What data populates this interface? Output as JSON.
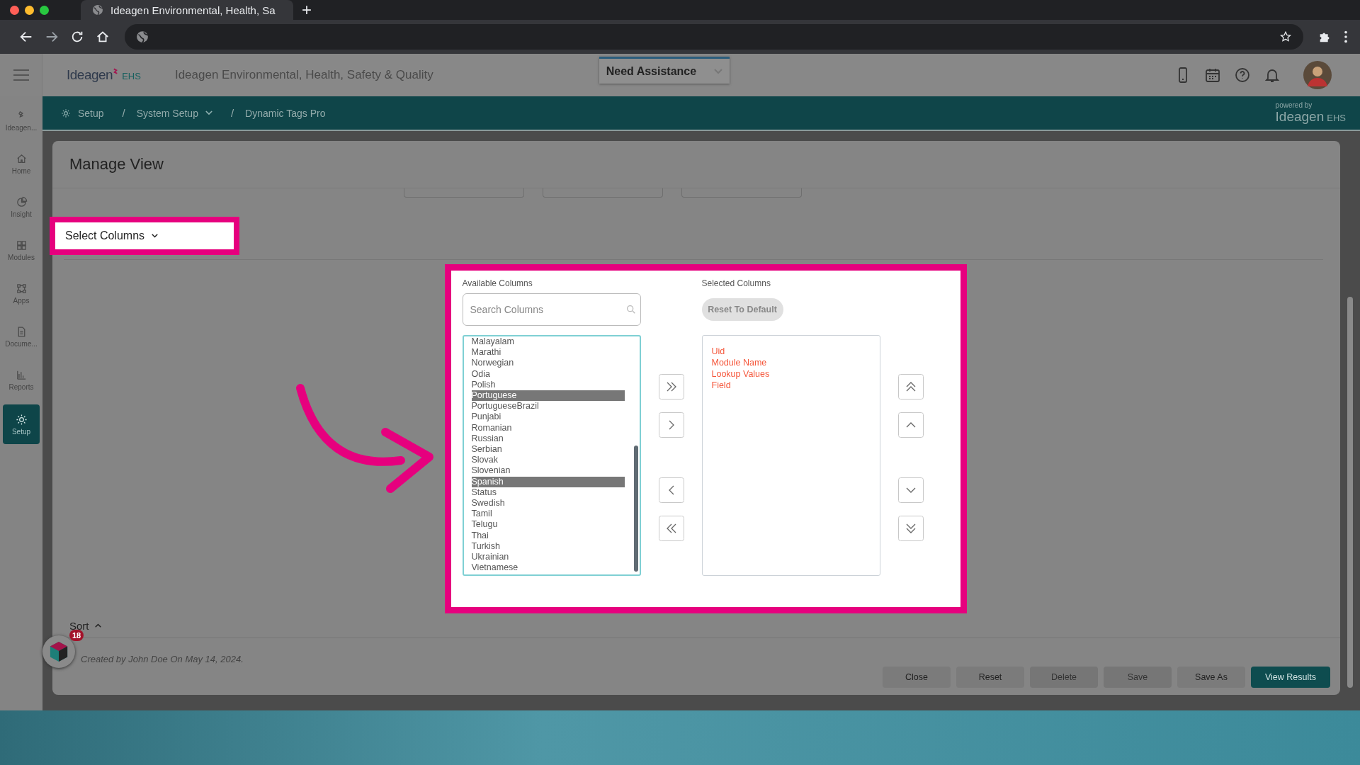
{
  "browser": {
    "tab_title": "Ideagen Environmental, Health, Sa",
    "new_tab": "+"
  },
  "header": {
    "logo": "Ideagen",
    "logo_suffix": "EHS",
    "title": "Ideagen Environmental, Health, Safety & Quality",
    "assistance": "Need Assistance"
  },
  "breadcrumb": {
    "separator": "/",
    "items": [
      {
        "label": "Setup",
        "dropdown": false
      },
      {
        "label": "System Setup",
        "dropdown": true
      },
      {
        "label": "Dynamic Tags Pro",
        "dropdown": false
      }
    ],
    "powered_by": "powered by",
    "brand": "Ideagen",
    "brand_suffix": "EHS"
  },
  "sidebar": {
    "items": [
      {
        "label": "Ideagen...",
        "selected": false
      },
      {
        "label": "Home",
        "selected": false
      },
      {
        "label": "Insight",
        "selected": false
      },
      {
        "label": "Modules",
        "selected": false
      },
      {
        "label": "Apps",
        "selected": false
      },
      {
        "label": "Docume...",
        "selected": false
      },
      {
        "label": "Reports",
        "selected": false
      },
      {
        "label": "Setup",
        "selected": true
      }
    ]
  },
  "page": {
    "title": "Manage View",
    "select_columns": "Select Columns"
  },
  "dialog": {
    "available_label": "Available Columns",
    "search": {
      "placeholder": "Search Columns"
    },
    "available": [
      {
        "label": "Malayalam",
        "selected": false
      },
      {
        "label": "Marathi",
        "selected": false
      },
      {
        "label": "Norwegian",
        "selected": false
      },
      {
        "label": "Odia",
        "selected": false
      },
      {
        "label": "Polish",
        "selected": false
      },
      {
        "label": "Portuguese",
        "selected": true
      },
      {
        "label": "PortugueseBrazil",
        "selected": false
      },
      {
        "label": "Punjabi",
        "selected": false
      },
      {
        "label": "Romanian",
        "selected": false
      },
      {
        "label": "Russian",
        "selected": false
      },
      {
        "label": "Serbian",
        "selected": false
      },
      {
        "label": "Slovak",
        "selected": false
      },
      {
        "label": "Slovenian",
        "selected": false
      },
      {
        "label": "Spanish",
        "selected": true
      },
      {
        "label": "Status",
        "selected": false
      },
      {
        "label": "Swedish",
        "selected": false
      },
      {
        "label": "Tamil",
        "selected": false
      },
      {
        "label": "Telugu",
        "selected": false
      },
      {
        "label": "Thai",
        "selected": false
      },
      {
        "label": "Turkish",
        "selected": false
      },
      {
        "label": "Ukrainian",
        "selected": false
      },
      {
        "label": "Vietnamese",
        "selected": false
      }
    ],
    "selected_label": "Selected Columns",
    "reset": "Reset To Default",
    "selected": [
      "Uid",
      "Module Name",
      "Lookup Values",
      "Field"
    ]
  },
  "footer": {
    "sort": "Sort",
    "created_by": "Created by John Doe On May 14, 2024.",
    "buttons": [
      {
        "label": "Close",
        "kind": "default",
        "disabled": false
      },
      {
        "label": "Reset",
        "kind": "default",
        "disabled": false
      },
      {
        "label": "Delete",
        "kind": "default",
        "disabled": true
      },
      {
        "label": "Save",
        "kind": "default",
        "disabled": true
      },
      {
        "label": "Save As",
        "kind": "default",
        "disabled": false
      },
      {
        "label": "View Results",
        "kind": "primary",
        "disabled": false
      }
    ]
  },
  "help_widget": {
    "badge": "18"
  }
}
